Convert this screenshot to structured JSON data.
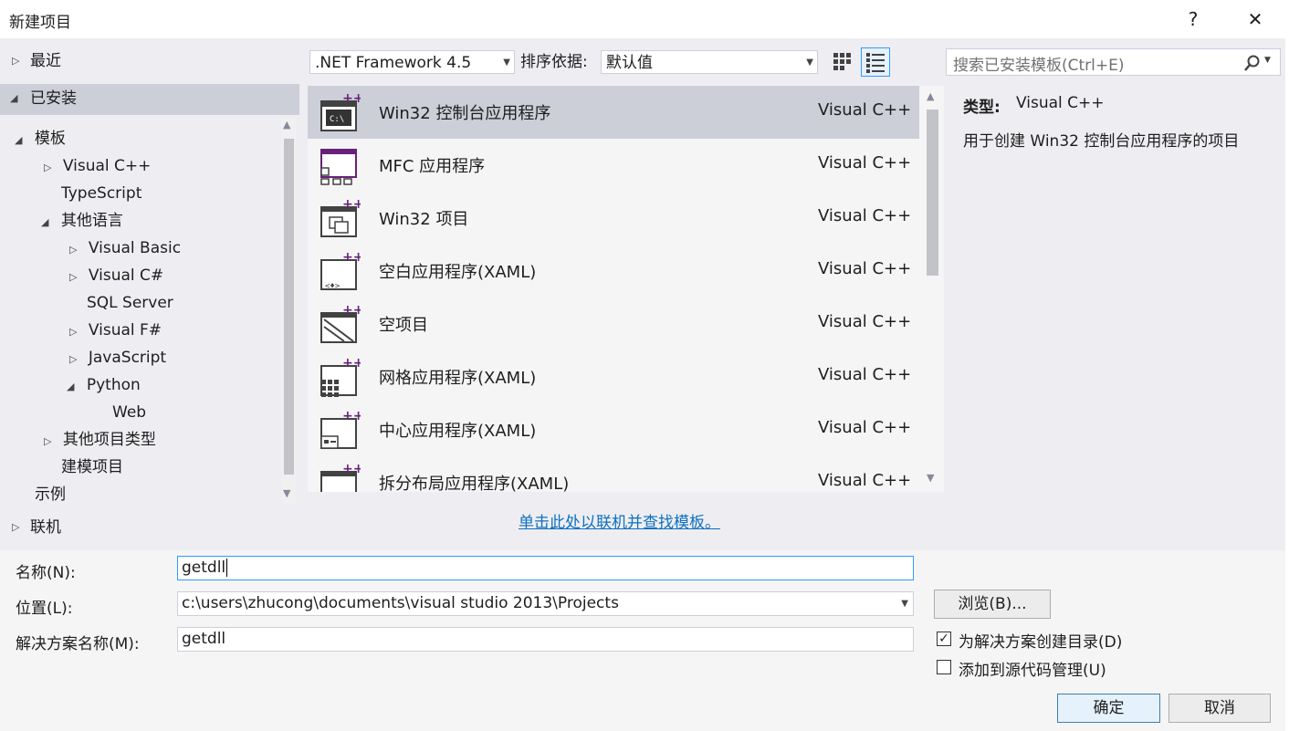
{
  "window": {
    "title": "新建项目",
    "help": "?",
    "close": "✕"
  },
  "nav": {
    "recent": "最近",
    "installed": "已安装",
    "online": "联机",
    "tree": [
      {
        "label": "模板"
      },
      {
        "label": "Visual C++"
      },
      {
        "label": "TypeScript"
      },
      {
        "label": "其他语言"
      },
      {
        "label": "Visual Basic"
      },
      {
        "label": "Visual C#"
      },
      {
        "label": "SQL Server"
      },
      {
        "label": "Visual F#"
      },
      {
        "label": "JavaScript"
      },
      {
        "label": "Python"
      },
      {
        "label": "Web"
      },
      {
        "label": "其他项目类型"
      },
      {
        "label": "建模项目"
      },
      {
        "label": "示例"
      }
    ]
  },
  "toolbar": {
    "framework": ".NET Framework 4.5",
    "sort_label": "排序依据:",
    "sort_value": "默认值"
  },
  "search": {
    "placeholder": "搜索已安装模板(Ctrl+E)"
  },
  "templates": [
    {
      "name": "Win32 控制台应用程序",
      "lang": "Visual C++",
      "icon": "console-app-icon"
    },
    {
      "name": "MFC 应用程序",
      "lang": "Visual C++",
      "icon": "mfc-app-icon"
    },
    {
      "name": "Win32 项目",
      "lang": "Visual C++",
      "icon": "win32-project-icon"
    },
    {
      "name": "空白应用程序(XAML)",
      "lang": "Visual C++",
      "icon": "blank-xaml-app-icon"
    },
    {
      "name": "空项目",
      "lang": "Visual C++",
      "icon": "empty-project-icon"
    },
    {
      "name": "网格应用程序(XAML)",
      "lang": "Visual C++",
      "icon": "grid-xaml-app-icon"
    },
    {
      "name": "中心应用程序(XAML)",
      "lang": "Visual C++",
      "icon": "hub-xaml-app-icon"
    },
    {
      "name": "拆分布局应用程序(XAML)",
      "lang": "Visual C++",
      "icon": "split-xaml-app-icon"
    }
  ],
  "online_link": "单击此处以联机并查找模板。",
  "description": {
    "type_label": "类型:",
    "type_value": "Visual C++",
    "text": "用于创建 Win32 控制台应用程序的项目"
  },
  "form": {
    "name_label": "名称(N):",
    "name_value": "getdll",
    "location_label": "位置(L):",
    "location_value": "c:\\users\\zhucong\\documents\\visual studio 2013\\Projects",
    "solution_label": "解决方案名称(M):",
    "solution_value": "getdll",
    "browse": "浏览(B)...",
    "create_dir": "为解决方案创建目录(D)",
    "create_dir_checked": true,
    "add_source": "添加到源代码管理(U)",
    "add_source_checked": false,
    "ok": "确定",
    "cancel": "取消"
  },
  "colors": {
    "selection": "#ccced8",
    "link": "#0e70c0",
    "accent_purple": "#68217a"
  }
}
